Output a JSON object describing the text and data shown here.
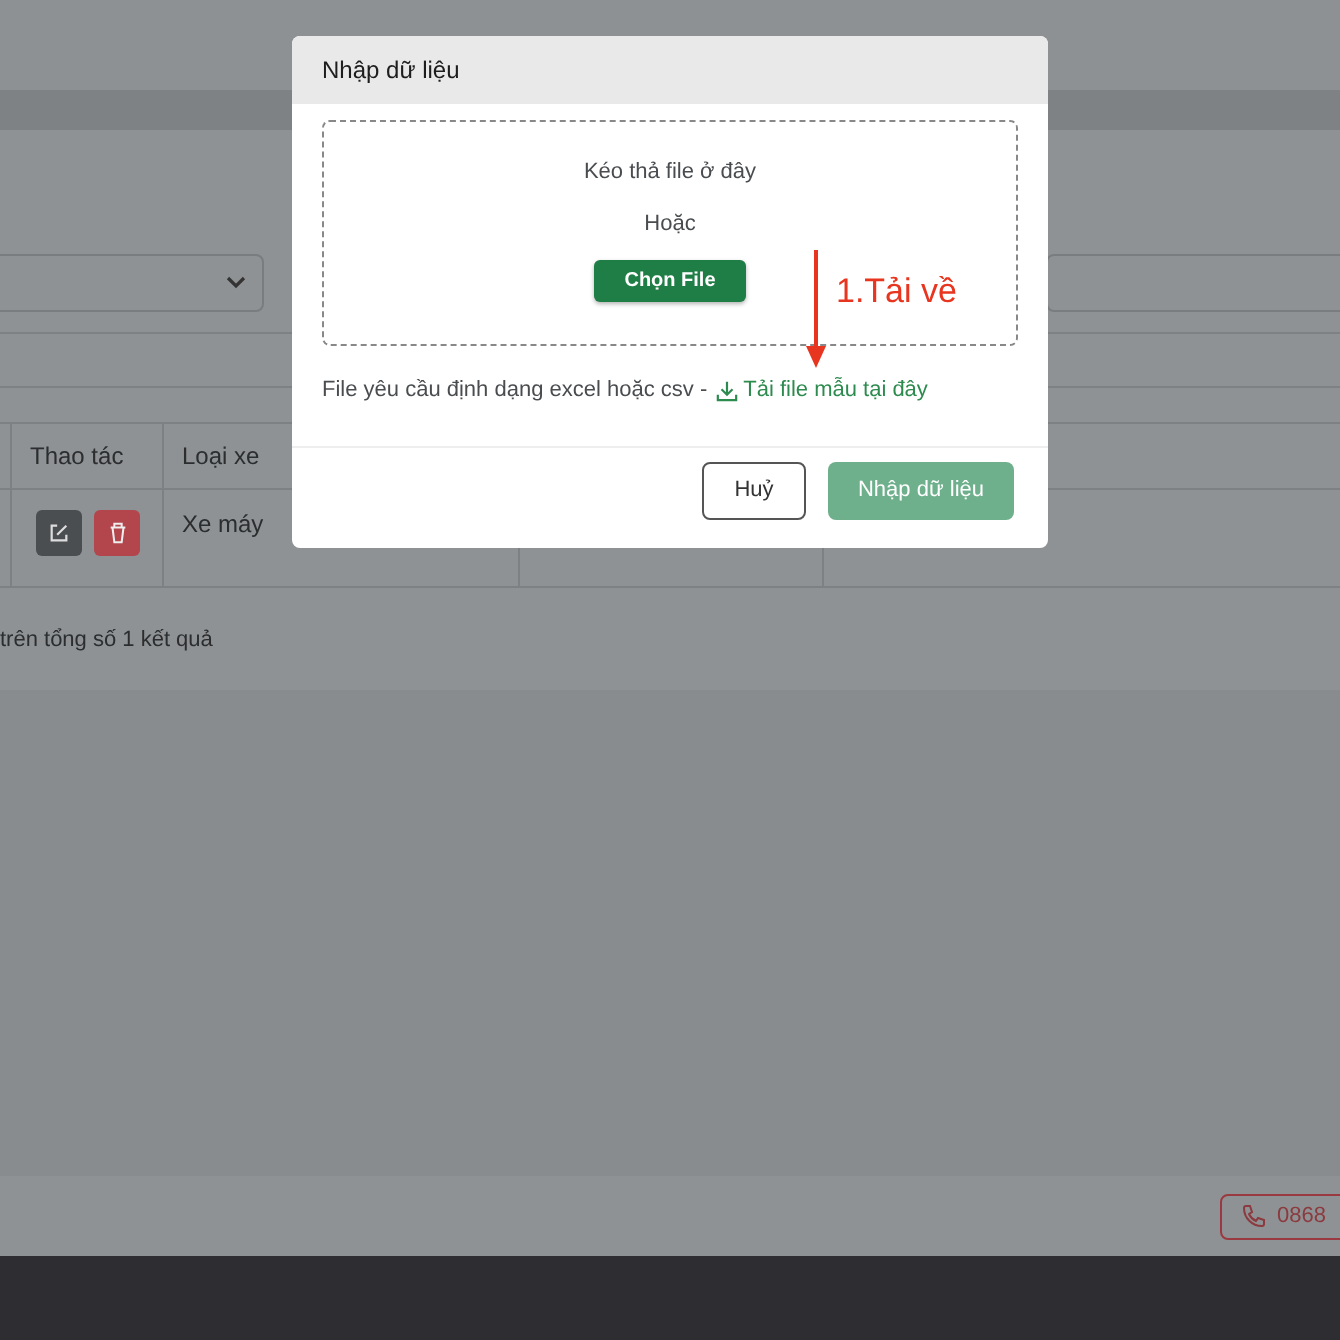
{
  "page": {
    "table": {
      "columns": [
        {
          "label": "Thao tác"
        },
        {
          "label": "Loại xe"
        }
      ],
      "rows": [
        {
          "vehicle_type": "Xe máy"
        }
      ]
    },
    "pagination_summary": "trên tổng số 1 kết quả",
    "footer": {
      "phone": "0868"
    }
  },
  "modal": {
    "title": "Nhập dữ liệu",
    "dropzone": {
      "prompt": "Kéo thả file ở đây",
      "or": "Hoặc",
      "choose_button": "Chọn File"
    },
    "hint": "File yêu cầu định dạng excel hoặc csv -",
    "template_link": "Tải file mẫu tại đây",
    "buttons": [
      {
        "label": "Huỷ",
        "kind": "secondary",
        "disabled": false
      },
      {
        "label": "Nhập dữ liệu",
        "kind": "primary",
        "disabled": true
      }
    ]
  },
  "annotation": {
    "text": "1.Tải về"
  }
}
